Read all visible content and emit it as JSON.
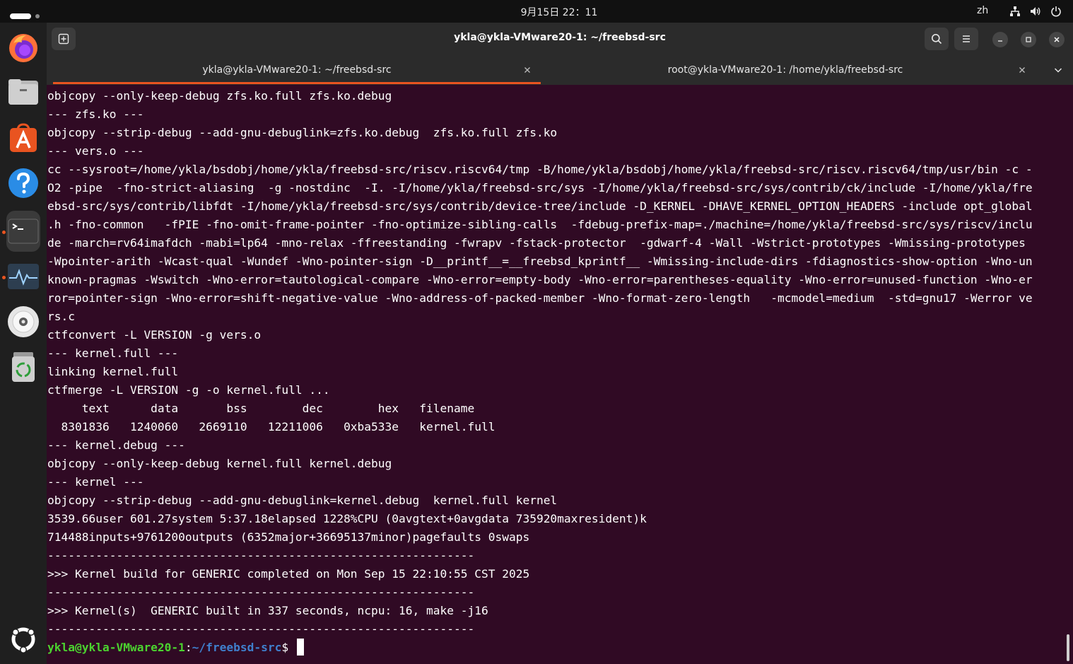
{
  "topbar": {
    "clock": "9月15日 22：11",
    "language": "zh"
  },
  "window": {
    "title": "ykla@ykla-VMware20-1: ~/freebsd-src"
  },
  "tabs": [
    {
      "label": "ykla@ykla-VMware20-1: ~/freebsd-src"
    },
    {
      "label": "root@ykla-VMware20-1: /home/ykla/freebsd-src"
    }
  ],
  "terminal": {
    "lines": [
      "objcopy --only-keep-debug zfs.ko.full zfs.ko.debug",
      "--- zfs.ko ---",
      "objcopy --strip-debug --add-gnu-debuglink=zfs.ko.debug  zfs.ko.full zfs.ko",
      "--- vers.o ---",
      "cc --sysroot=/home/ykla/bsdobj/home/ykla/freebsd-src/riscv.riscv64/tmp -B/home/ykla/bsdobj/home/ykla/freebsd-src/riscv.riscv64/tmp/usr/bin -c -",
      "O2 -pipe  -fno-strict-aliasing  -g -nostdinc  -I. -I/home/ykla/freebsd-src/sys -I/home/ykla/freebsd-src/sys/contrib/ck/include -I/home/ykla/fre",
      "ebsd-src/sys/contrib/libfdt -I/home/ykla/freebsd-src/sys/contrib/device-tree/include -D_KERNEL -DHAVE_KERNEL_OPTION_HEADERS -include opt_global",
      ".h -fno-common   -fPIE -fno-omit-frame-pointer -fno-optimize-sibling-calls  -fdebug-prefix-map=./machine=/home/ykla/freebsd-src/sys/riscv/inclu",
      "de -march=rv64imafdch -mabi=lp64 -mno-relax -ffreestanding -fwrapv -fstack-protector  -gdwarf-4 -Wall -Wstrict-prototypes -Wmissing-prototypes",
      "-Wpointer-arith -Wcast-qual -Wundef -Wno-pointer-sign -D__printf__=__freebsd_kprintf__ -Wmissing-include-dirs -fdiagnostics-show-option -Wno-un",
      "known-pragmas -Wswitch -Wno-error=tautological-compare -Wno-error=empty-body -Wno-error=parentheses-equality -Wno-error=unused-function -Wno-er",
      "ror=pointer-sign -Wno-error=shift-negative-value -Wno-address-of-packed-member -Wno-format-zero-length   -mcmodel=medium  -std=gnu17 -Werror ve",
      "rs.c",
      "ctfconvert -L VERSION -g vers.o",
      "--- kernel.full ---",
      "linking kernel.full",
      "ctfmerge -L VERSION -g -o kernel.full ...",
      "     text      data       bss        dec        hex   filename",
      "  8301836   1240060   2669110   12211006   0xba533e   kernel.full",
      "--- kernel.debug ---",
      "objcopy --only-keep-debug kernel.full kernel.debug",
      "--- kernel ---",
      "objcopy --strip-debug --add-gnu-debuglink=kernel.debug  kernel.full kernel",
      "3539.66user 601.27system 5:37.18elapsed 1228%CPU (0avgtext+0avgdata 735920maxresident)k",
      "714488inputs+9761200outputs (6352major+36695137minor)pagefaults 0swaps",
      "--------------------------------------------------------------",
      ">>> Kernel build for GENERIC completed on Mon Sep 15 22:10:55 CST 2025",
      "--------------------------------------------------------------",
      ">>> Kernel(s)  GENERIC built in 337 seconds, ncpu: 16, make -j16",
      "--------------------------------------------------------------"
    ],
    "prompt": {
      "user_host": "ykla@ykla-VMware20-1",
      "separator": ":",
      "path": "~/freebsd-src",
      "symbol": "$ "
    }
  },
  "colors": {
    "terminal_bg": "#300a24",
    "accent": "#e95420",
    "prompt_user": "#4bd32f",
    "prompt_path": "#3f7fcc"
  },
  "icons": {
    "dock": [
      "firefox-icon",
      "files-icon",
      "app-center-icon",
      "help-icon",
      "terminal-icon",
      "system-monitor-icon",
      "disc-icon",
      "trash-icon",
      "show-apps-icon"
    ],
    "header": [
      "new-tab-icon",
      "search-icon",
      "hamburger-menu-icon",
      "minimize-icon",
      "maximize-icon",
      "close-icon"
    ],
    "system": [
      "network-icon",
      "volume-icon",
      "power-icon"
    ]
  }
}
